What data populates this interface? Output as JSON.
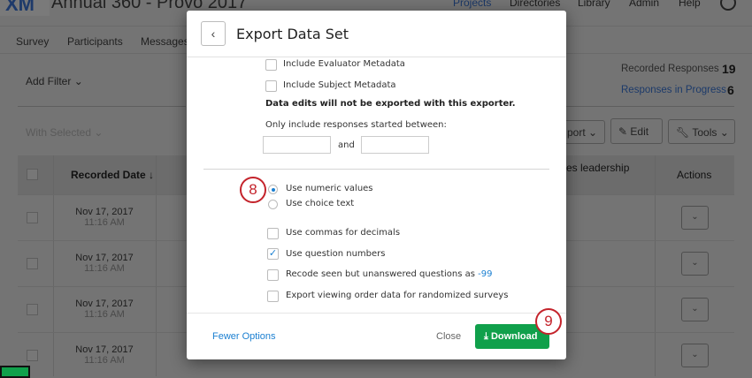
{
  "app": {
    "logo": "XM",
    "project_title": "Annual 360 - Provo 2017",
    "nav": [
      "Projects",
      "Directories",
      "Library",
      "Admin",
      "Help"
    ]
  },
  "tabs": [
    "Survey",
    "Participants",
    "Messages"
  ],
  "filter": {
    "add_filter": "Add Filter",
    "with_selected": "With Selected"
  },
  "stats": {
    "recorded_label": "Recorded Responses",
    "recorded_value": "19",
    "progress_label": "Responses in Progress",
    "progress_value": "6"
  },
  "toolbar": {
    "export": "port",
    "edit": "Edit",
    "tools": "Tools"
  },
  "table": {
    "headers": {
      "recorded_date": "Recorded Date",
      "col3": "es leadership",
      "actions": "Actions"
    },
    "rows": [
      {
        "date": "Nov 17, 2017",
        "time": "11:16 AM"
      },
      {
        "date": "Nov 17, 2017",
        "time": "11:16 AM"
      },
      {
        "date": "Nov 17, 2017",
        "time": "11:16 AM"
      },
      {
        "date": "Nov 17, 2017",
        "time": "11:16 AM"
      }
    ]
  },
  "modal": {
    "title": "Export Data Set",
    "include_evaluator": "Include Evaluator Metadata",
    "include_subject": "Include Subject Metadata",
    "warning": "Data edits will not be exported with this exporter.",
    "date_range_label": "Only include responses started between:",
    "and": "and",
    "radio_numeric": "Use numeric values",
    "radio_choice": "Use choice text",
    "commas": "Use commas for decimals",
    "question_numbers": "Use question numbers",
    "recode": "Recode seen but unanswered questions as",
    "recode_value": "-99",
    "viewing_order": "Export viewing order data for randomized surveys",
    "fewer_options": "Fewer Options",
    "close": "Close",
    "download": "Download"
  },
  "annotations": {
    "step8": "8",
    "step9": "9"
  }
}
